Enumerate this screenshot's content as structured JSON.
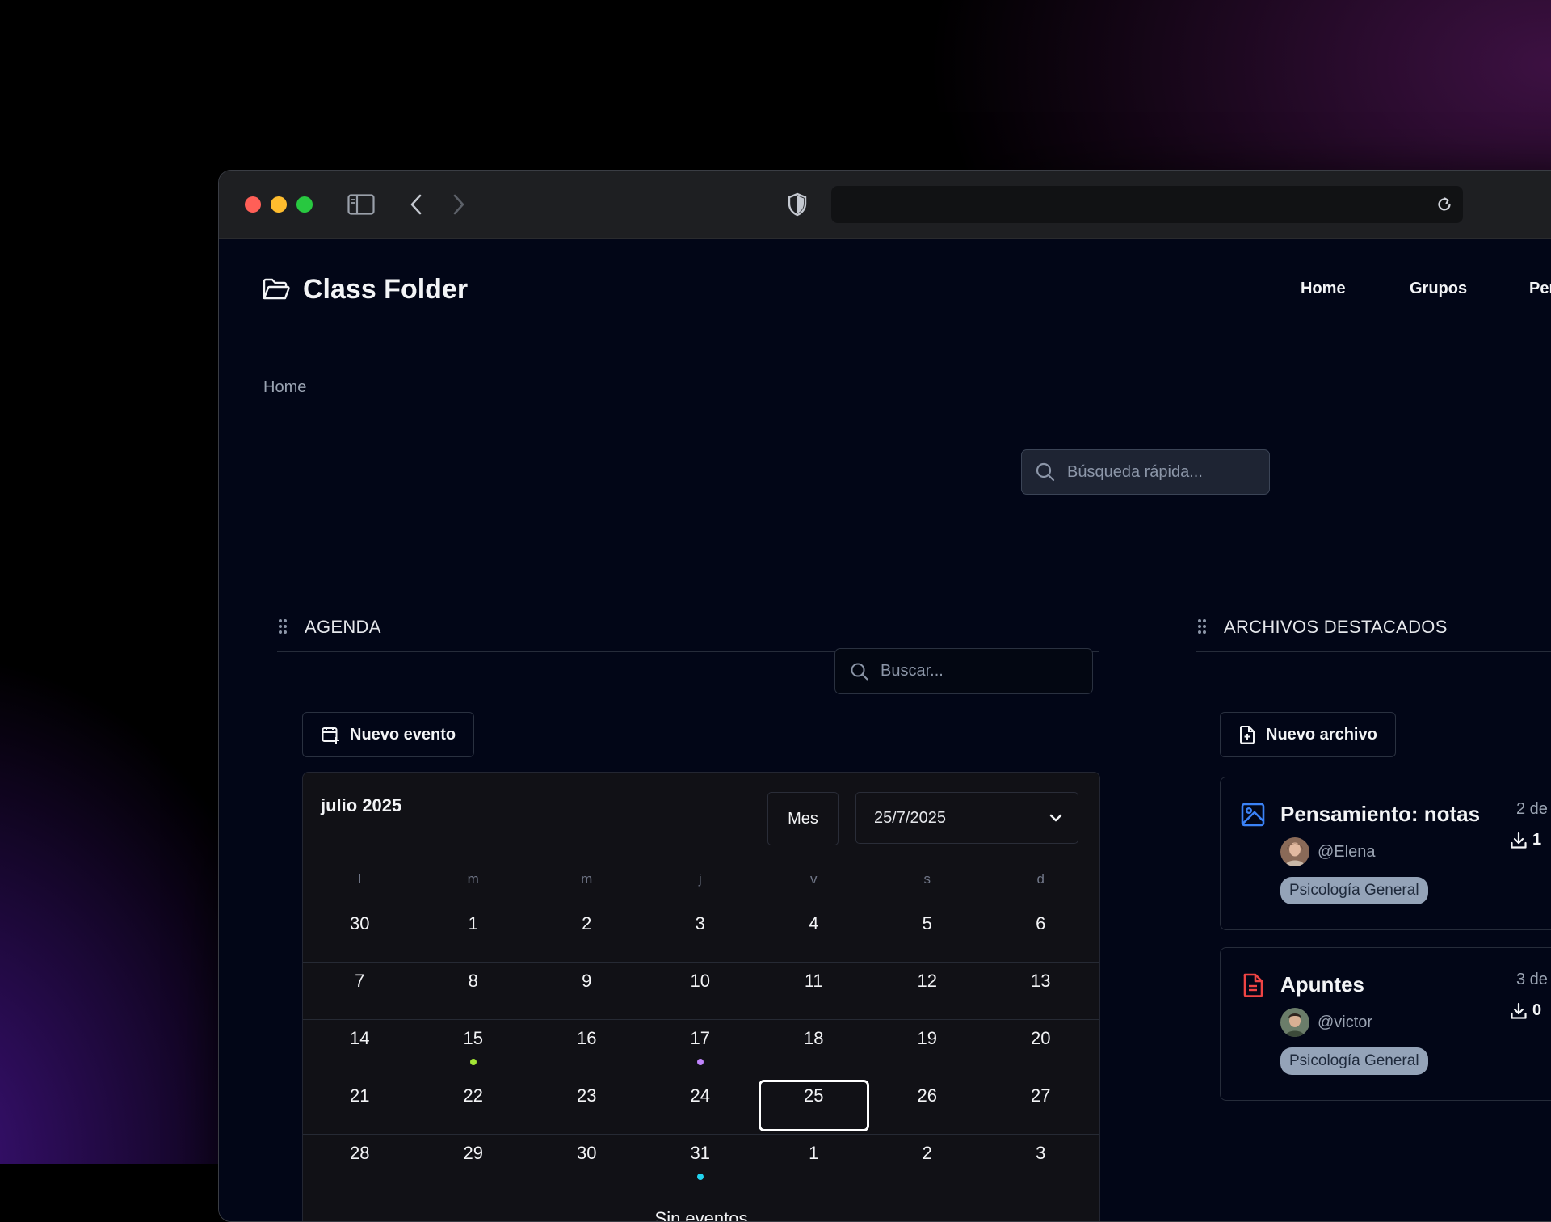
{
  "app": {
    "title": "Class Folder"
  },
  "nav": {
    "items": [
      "Home",
      "Grupos",
      "Per"
    ]
  },
  "breadcrumb": {
    "current": "Home"
  },
  "quick_search": {
    "placeholder": "Búsqueda rápida..."
  },
  "agenda": {
    "title": "AGENDA",
    "search_placeholder": "Buscar...",
    "new_event_label": "Nuevo evento",
    "calendar": {
      "month_title": "julio 2025",
      "view_label": "Mes",
      "selected_date": "25/7/2025",
      "weekdays": [
        "l",
        "m",
        "m",
        "j",
        "v",
        "s",
        "d"
      ],
      "weeks": [
        [
          "30",
          "1",
          "2",
          "3",
          "4",
          "5",
          "6"
        ],
        [
          "7",
          "8",
          "9",
          "10",
          "11",
          "12",
          "13"
        ],
        [
          "14",
          "15",
          "16",
          "17",
          "18",
          "19",
          "20"
        ],
        [
          "21",
          "22",
          "23",
          "24",
          "25",
          "26",
          "27"
        ],
        [
          "28",
          "29",
          "30",
          "31",
          "1",
          "2",
          "3"
        ]
      ],
      "today": "25",
      "event_dot_colors": {
        "15": "#a3e635",
        "17": "#c084fc",
        "31": "#22d3ee"
      },
      "empty_label": "Sin eventos"
    }
  },
  "files": {
    "title": "ARCHIVOS DESTACADOS",
    "new_file_label": "Nuevo archivo",
    "items": [
      {
        "title": "Pensamiento: notas",
        "author": "@Elena",
        "tag": "Psicología General",
        "date": "2 de",
        "downloads": "1",
        "icon": "image-icon"
      },
      {
        "title": "Apuntes",
        "author": "@victor",
        "tag": "Psicología General",
        "date": "3 de",
        "downloads": "0",
        "icon": "document-icon"
      }
    ]
  },
  "colors": {
    "page_bg": "#020617",
    "calendar_bg": "#111116",
    "tag_bg": "#94a3b8",
    "image_icon": "#3b82f6",
    "doc_icon": "#ef4444"
  }
}
